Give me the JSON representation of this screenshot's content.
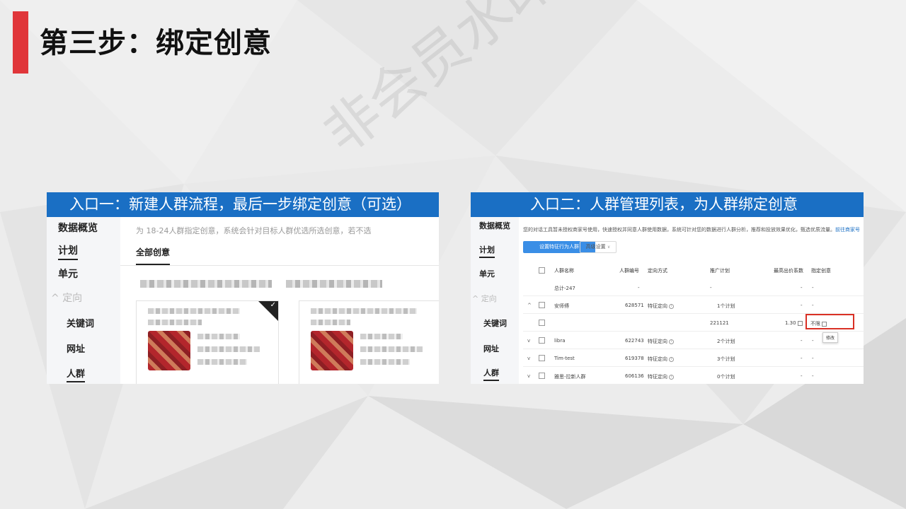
{
  "slide": {
    "title": "第三步：绑定创意",
    "watermark": "非会员水印",
    "accent_color": "#e0363a",
    "header_color": "#1a6fc4"
  },
  "left_panel": {
    "header": "入口一：新建人群流程，最后一步绑定创意（可选）",
    "nav": [
      "数据概览",
      "计划",
      "单元",
      "定向",
      "关键词",
      "网址",
      "人群"
    ],
    "description": "为    18-24人群指定创意，系统会针对目标人群优选所选创意，若不选",
    "tab": "全部创意"
  },
  "right_panel": {
    "header": "入口二：人群管理列表，为人群绑定创意",
    "nav": [
      "数据概览",
      "计划",
      "单元",
      "定向",
      "关键词",
      "网址",
      "人群"
    ],
    "description": "您的对话工具暂未授权商家号使用，快速授权并同意人群使用数据，系统可针对您的数据进行人群分析，推荐和投放效果优化，甄选优质流量。",
    "description_link": "前往商家号",
    "btn_set_feature": "设置特征行为人群",
    "btn_advanced": "高级设置",
    "columns": [
      "人群名称",
      "人群编号",
      "定向方式",
      "推广计划",
      "最高出价系数",
      "指定创意"
    ],
    "rows": [
      {
        "expand": "",
        "name": "总计-247",
        "id": "",
        "method": "-",
        "plan": "-",
        "bid": "-",
        "creative": "-"
      },
      {
        "expand": "^",
        "name": "安师傅",
        "id": "628571",
        "method": "特征定向",
        "plan": "1个计划",
        "bid": "-",
        "creative": "-"
      },
      {
        "expand": "",
        "name": "",
        "id": "",
        "method": "",
        "plan": "221121",
        "bid": "1.30",
        "creative": "不限"
      },
      {
        "expand": "v",
        "name": "libra",
        "id": "622743",
        "method": "特征定向",
        "plan": "2个计划",
        "bid": "-",
        "creative": "-"
      },
      {
        "expand": "v",
        "name": "Tim-test",
        "id": "619378",
        "method": "特征定向",
        "plan": "3个计划",
        "bid": "-",
        "creative": "-"
      },
      {
        "expand": "v",
        "name": "雅思-拉新人群",
        "id": "606136",
        "method": "特征定向",
        "plan": "0个计划",
        "bid": "-",
        "creative": "-"
      }
    ],
    "tooltip": "修改"
  }
}
